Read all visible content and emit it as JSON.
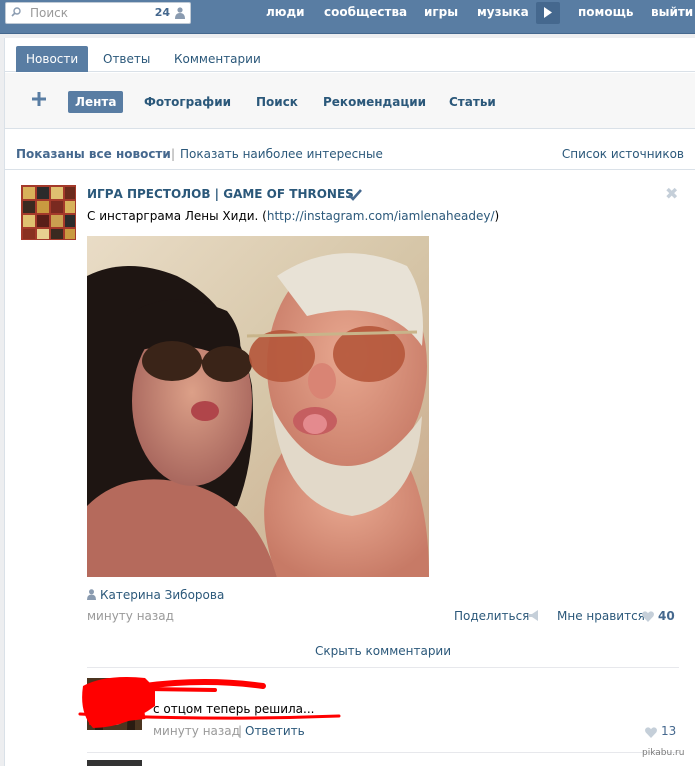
{
  "topbar": {
    "search_placeholder": "Поиск",
    "search_count": "24",
    "nav": [
      "люди",
      "сообщества",
      "игры",
      "музыка",
      "помощь",
      "выйти"
    ]
  },
  "tabs": [
    "Новости",
    "Ответы",
    "Комментарии"
  ],
  "subnav": [
    "Лента",
    "Фотографии",
    "Поиск",
    "Рекомендации",
    "Статьи"
  ],
  "filter": {
    "shown_all": "Показаны все новости",
    "separator": "|",
    "show_interesting": "Показать наиболее интересные",
    "sources": "Список источников"
  },
  "post": {
    "author": "ИГРА ПРЕСТОЛОВ | GAME OF THRONES",
    "text": "С инстарграма Лены Хиди. (",
    "link": "http://instagram.com/iamlenaheadey/",
    "text_end": ")",
    "caption_user": "Катерина Зиборова",
    "time": "минуту назад",
    "share": "Поделиться",
    "like": "Мне нравится",
    "like_count": "40",
    "hide_comments": "Скрыть комментарии"
  },
  "comment": {
    "text": "с отцом теперь решила...",
    "time": "минуту назад",
    "separator": "|",
    "reply": "Ответить",
    "likes": "13"
  },
  "watermark": "pikabu.ru",
  "colors": {
    "header": "#597da3",
    "link": "#2b587a",
    "scribble": "#ff0000"
  }
}
